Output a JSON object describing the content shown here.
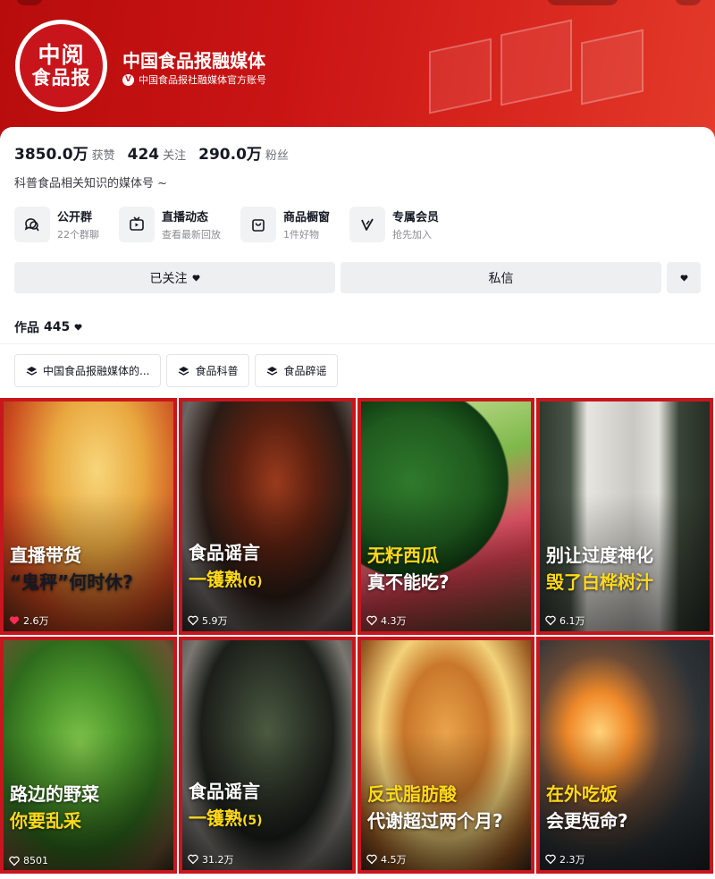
{
  "profile": {
    "name": "中国食品报融媒体",
    "logo_line1": "中阅",
    "logo_line2": "食品报",
    "verify_badge": "V",
    "verification": "中国食品报社融媒体官方账号",
    "bio": "科普食品相关知识的媒体号 ~"
  },
  "stats": [
    {
      "value": "3850.0万",
      "label": "获赞"
    },
    {
      "value": "424",
      "label": "关注"
    },
    {
      "value": "290.0万",
      "label": "粉丝"
    }
  ],
  "features": [
    {
      "icon": "group-chat-icon",
      "title": "公开群",
      "sub": "22个群聊"
    },
    {
      "icon": "live-tv-icon",
      "title": "直播动态",
      "sub": "查看最新回放"
    },
    {
      "icon": "shop-bag-icon",
      "title": "商品橱窗",
      "sub": "1件好物"
    },
    {
      "icon": "vip-v-icon",
      "title": "专属会员",
      "sub": "抢先加入"
    }
  ],
  "buttons": {
    "follow": "已关注",
    "message": "私信"
  },
  "works": {
    "label": "作品",
    "count": "445"
  },
  "collections": [
    "中国食品报融媒体的...",
    "食品科普",
    "食品辟谣"
  ],
  "videos": [
    {
      "line1": "直播带货",
      "line2": "“鬼秤”何时休?",
      "line2_color": "#ffd91a",
      "likes": "2.6万",
      "liked": true
    },
    {
      "line1": "食品谣言",
      "line2": "一镬熟",
      "line2_suffix": "(6)",
      "line2_color": "#ffd91a",
      "likes": "5.9万",
      "liked": false
    },
    {
      "line1": "无籽西瓜",
      "line2": "真不能吃?",
      "line1_color": "#ffd91a",
      "line2_color": "#ffffff",
      "likes": "4.3万",
      "liked": false
    },
    {
      "line1": "别让过度神化",
      "line2": "毁了白桦树汁",
      "line2_color": "#ffd91a",
      "likes": "6.1万",
      "liked": false
    },
    {
      "line1": "路边的野菜",
      "line2": "你要乱采",
      "line2_color": "#ffd91a",
      "likes": "8501",
      "liked": false
    },
    {
      "line1": "食品谣言",
      "line2": "一镬熟",
      "line2_suffix": "(5)",
      "line2_color": "#ffd91a",
      "likes": "31.2万",
      "liked": false
    },
    {
      "line1": "反式脂肪酸",
      "line2": "代谢超过两个月?",
      "line1_color": "#ffd91a",
      "line2_color": "#ffffff",
      "likes": "4.5万",
      "liked": false
    },
    {
      "line1": "在外吃饭",
      "line2": "会更短命?",
      "line1_color": "#ffd91a",
      "line2_color": "#ffffff",
      "likes": "2.3万",
      "liked": false
    }
  ],
  "colors": {
    "brand_red": "#c7161d",
    "accent_yellow": "#ffd91a",
    "like_red": "#fe2c55"
  }
}
